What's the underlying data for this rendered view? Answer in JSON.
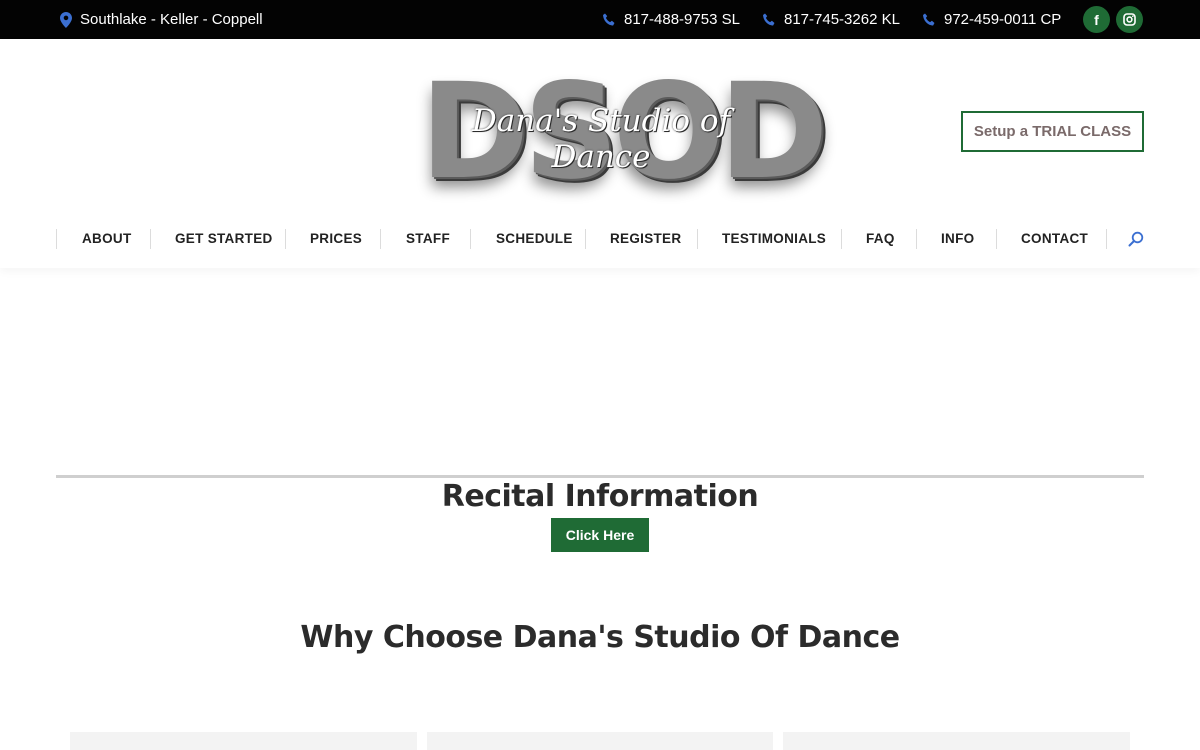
{
  "topbar": {
    "location": "Southlake - Keller - Coppell",
    "phones": [
      "817-488-9753 SL",
      "817-745-3262 KL",
      "972-459-0011 CP"
    ],
    "social": [
      {
        "label": "f",
        "icon": "facebook-icon"
      },
      {
        "label": "instagram",
        "icon": "instagram-icon"
      }
    ]
  },
  "logo": {
    "letters": "DSOD",
    "script": "Dana's Studio of Dance"
  },
  "header": {
    "trial_label": "Setup a TRIAL CLASS"
  },
  "nav": {
    "items": [
      "ABOUT",
      "GET STARTED",
      "PRICES",
      "STAFF",
      "SCHEDULE",
      "REGISTER",
      "TESTIMONIALS",
      "FAQ",
      "INFO",
      "CONTACT"
    ],
    "search_icon": "search-icon"
  },
  "main": {
    "recital_title": "Recital Information",
    "click_label": "Click Here",
    "why_title": "Why Choose Dana's Studio Of Dance"
  },
  "colors": {
    "topbar_bg": "#030303",
    "accent_green": "#1f6b35",
    "icon_blue": "#3b6fd1",
    "heading": "#2b2b2b"
  }
}
